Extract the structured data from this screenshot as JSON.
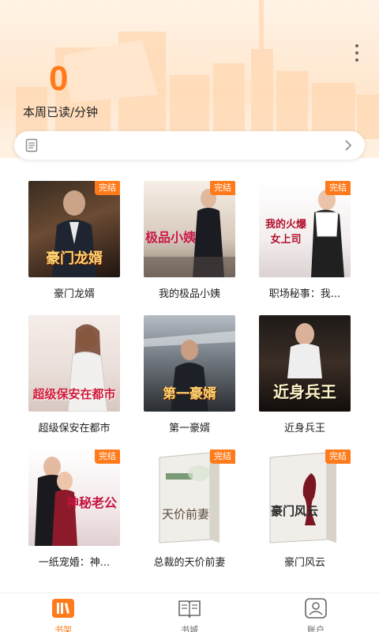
{
  "header": {
    "weekly_read_minutes": "0",
    "weekly_read_label": "本周已读/分钟"
  },
  "search": {
    "placeholder": ""
  },
  "books": [
    {
      "title": "豪门龙婿",
      "cover_text": "豪门龙婿",
      "badge": "完结"
    },
    {
      "title": "我的极品小姨",
      "cover_text": "极品小姨",
      "badge": "完结"
    },
    {
      "title": "职场秘事：我...",
      "cover_text": "我的火爆女上司",
      "badge": "完结"
    },
    {
      "title": "超级保安在都市",
      "cover_text": "超级保安在都市",
      "badge": ""
    },
    {
      "title": "第一豪婿",
      "cover_text": "第一豪婿",
      "badge": ""
    },
    {
      "title": "近身兵王",
      "cover_text": "近身兵王",
      "badge": ""
    },
    {
      "title": "一纸宠婚：神...",
      "cover_text": "神秘老公",
      "badge": "完结"
    },
    {
      "title": "总裁的天价前妻",
      "cover_text": "天价前妻",
      "badge": "完结"
    },
    {
      "title": "豪门风云",
      "cover_text": "豪门风云",
      "badge": "完结"
    }
  ],
  "bottom_nav": {
    "bookshelf": "书架",
    "bookstore": "书城",
    "account": "账户"
  },
  "colors": {
    "accent": "#ff7a1a"
  }
}
